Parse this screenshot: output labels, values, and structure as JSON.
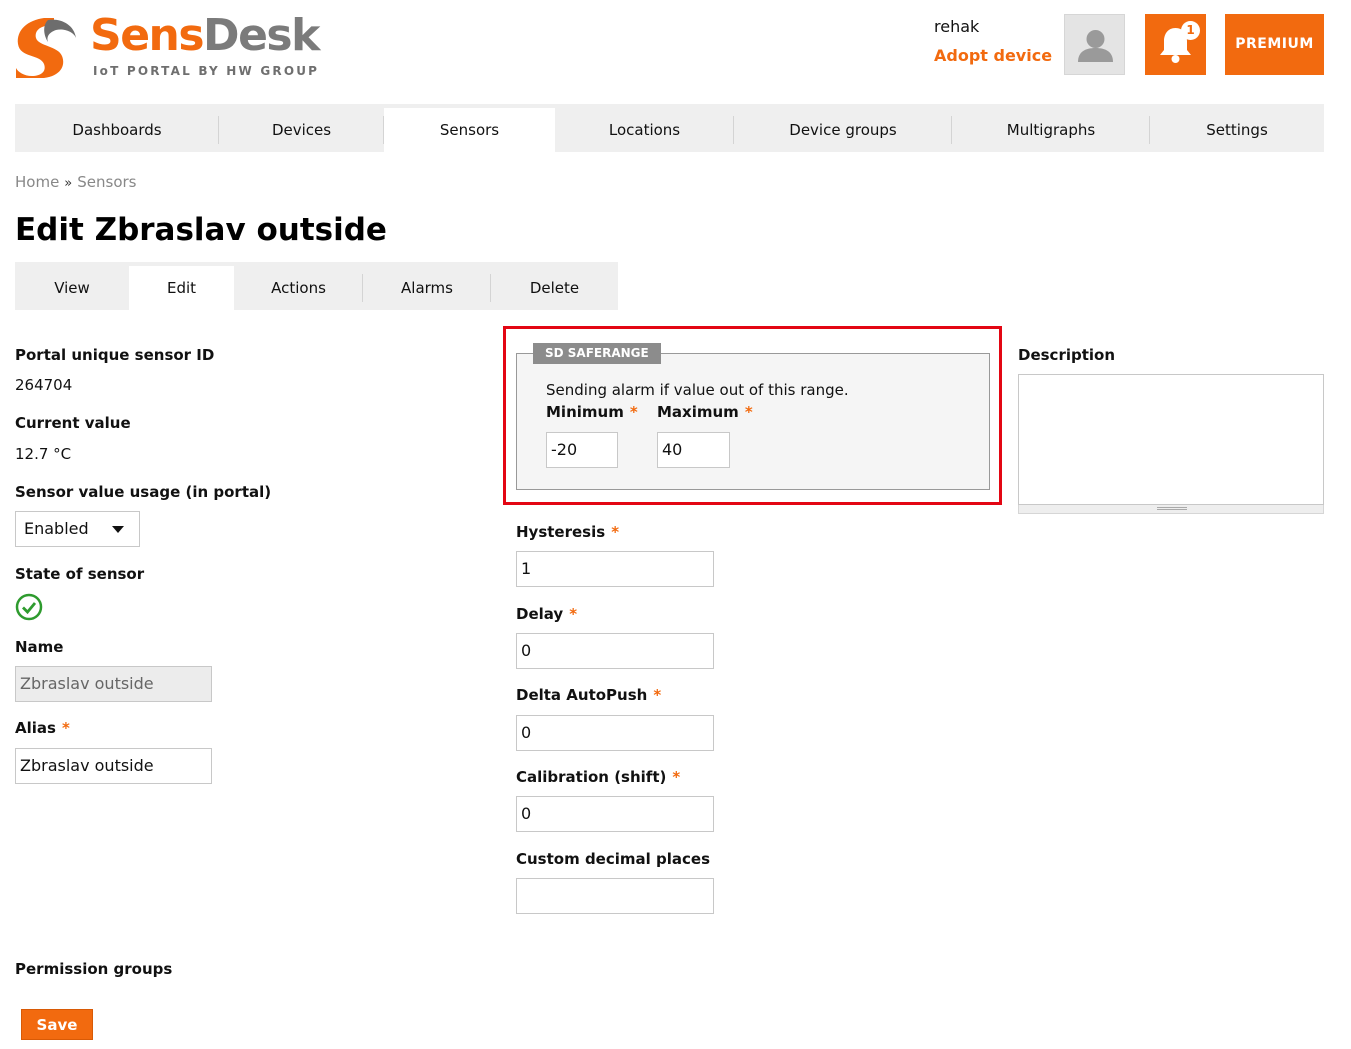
{
  "brand": {
    "name_part1": "Sens",
    "name_part2": "Desk",
    "tagline": "IoT PORTAL BY HW GROUP",
    "colors": {
      "accent": "#f26a0f",
      "gray": "#7b7b7b"
    }
  },
  "header": {
    "username": "rehak",
    "adopt_label": "Adopt device",
    "notification_count": "1",
    "premium_label": "PREMIUM",
    "icons": [
      "user-icon",
      "bell-icon"
    ]
  },
  "main_nav": {
    "tabs": [
      "Dashboards",
      "Devices",
      "Sensors",
      "Locations",
      "Device groups",
      "Multigraphs",
      "Settings"
    ],
    "active": "Sensors"
  },
  "breadcrumb": {
    "home": "Home",
    "separator": "»",
    "current": "Sensors"
  },
  "page_title": "Edit Zbraslav outside",
  "sub_nav": {
    "tabs": [
      "View",
      "Edit",
      "Actions",
      "Alarms",
      "Delete"
    ],
    "active": "Edit"
  },
  "left": {
    "sensor_id_label": "Portal unique sensor ID",
    "sensor_id_value": "264704",
    "current_value_label": "Current value",
    "current_value": "12.7 °C",
    "usage_label": "Sensor value usage (in portal)",
    "usage_value": "Enabled",
    "state_label": "State of sensor",
    "state_icon": "check-circle-icon",
    "name_label": "Name",
    "name_value": "Zbraslav outside",
    "alias_label": "Alias",
    "alias_value": "Zbraslav outside",
    "required_mark": "*"
  },
  "saferange": {
    "legend": "SD SAFERANGE",
    "note": "Sending alarm if value out of this range.",
    "min_label": "Minimum",
    "min_value": "-20",
    "max_label": "Maximum",
    "max_value": "40",
    "highlight_color": "#e30613"
  },
  "middle": {
    "hysteresis_label": "Hysteresis",
    "hysteresis_value": "1",
    "delay_label": "Delay",
    "delay_value": "0",
    "delta_label": "Delta AutoPush",
    "delta_value": "0",
    "calibration_label": "Calibration (shift)",
    "calibration_value": "0",
    "decimal_label": "Custom decimal places",
    "decimal_value": ""
  },
  "right": {
    "description_label": "Description",
    "description_value": ""
  },
  "footer": {
    "permission_label": "Permission groups",
    "save_label": "Save"
  }
}
